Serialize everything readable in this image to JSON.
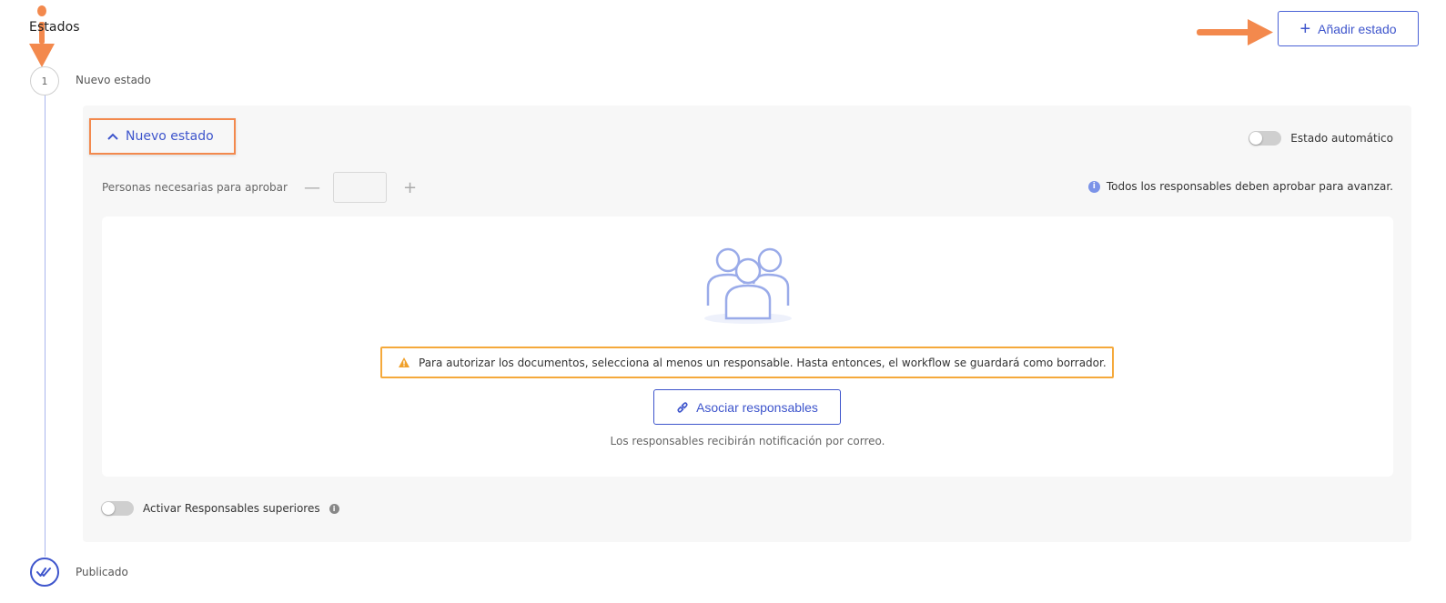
{
  "section": {
    "title": "Estados"
  },
  "header": {
    "add_state_label": "Añadir estado"
  },
  "timeline": {
    "steps": [
      {
        "number": "1",
        "label": "Nuevo estado"
      }
    ],
    "published_label": "Publicado"
  },
  "state": {
    "collapse_label": "Nuevo estado",
    "auto_toggle_label": "Estado automático",
    "approvers_label": "Personas necesarias para aprobar",
    "approvers_value": "",
    "approvers_minus": "—",
    "approvers_plus": "+",
    "info_note": "Todos los responsables deben aprobar para avanzar.",
    "warning_text": "Para autorizar los documentos, selecciona al menos un responsable. Hasta entonces, el workflow se guardará como borrador.",
    "associate_label": "Asociar responsables",
    "notify_text": "Los responsables recibirán notificación por correo.",
    "superiors_label": "Activar Responsables superiores"
  },
  "colors": {
    "accent": "#3e55cc",
    "annotation": "#f3894d",
    "warning": "#f5a93b",
    "timeline": "#a9b6ee"
  },
  "icons": {
    "add": "plus-icon",
    "collapse": "chevron-up-icon",
    "info": "info-icon",
    "warning": "warning-icon",
    "link": "link-icon",
    "illustration": "people-group-icon",
    "published": "double-check-icon"
  }
}
